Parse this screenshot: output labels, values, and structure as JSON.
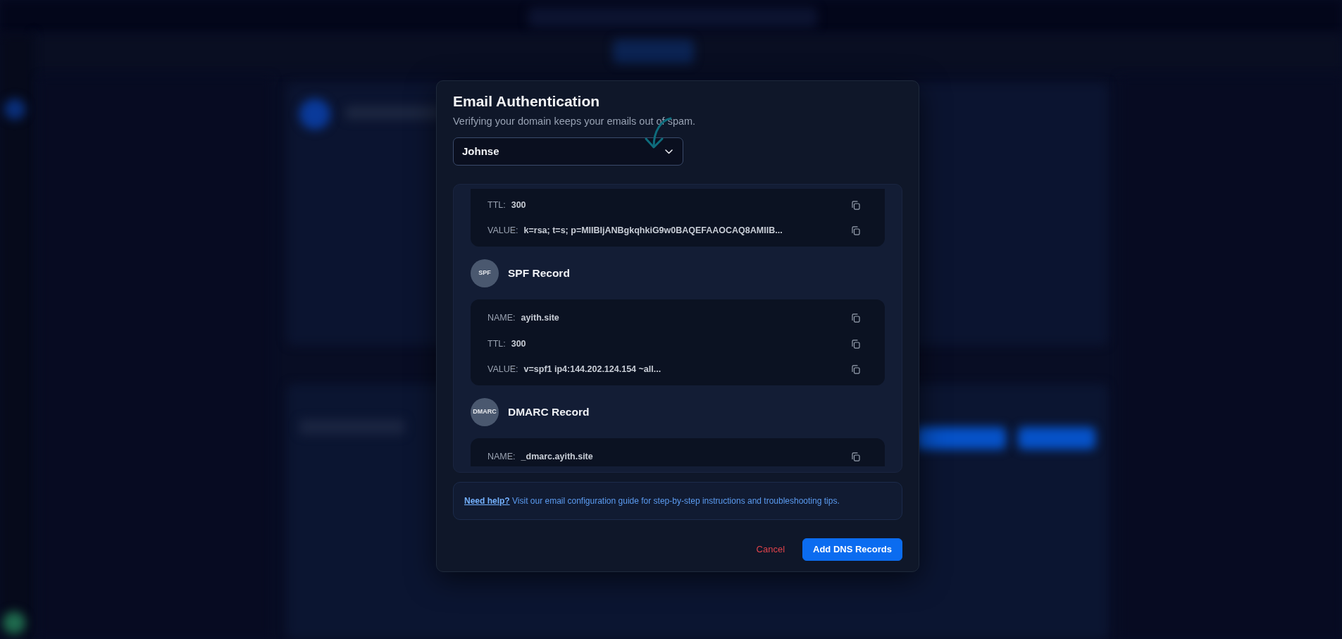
{
  "dialog": {
    "title": "Email Authentication",
    "subtitle": "Verifying your domain keeps your emails out of spam.",
    "domain_select": {
      "value": "Johnse"
    },
    "records": [
      {
        "rows": [
          {
            "label": "TTL:",
            "value": "300"
          },
          {
            "label": "VALUE:",
            "value": "k=rsa; t=s; p=MIIBIjANBgkqhkiG9w0BAQEFAAOCAQ8AMIIB..."
          }
        ]
      },
      {
        "badge": "SPF",
        "title": "SPF Record",
        "rows": [
          {
            "label": "NAME:",
            "value": "ayith.site"
          },
          {
            "label": "TTL:",
            "value": "300"
          },
          {
            "label": "VALUE:",
            "value": "v=spf1 ip4:144.202.124.154 ~all..."
          }
        ]
      },
      {
        "badge": "DMARC",
        "title": "DMARC Record",
        "rows": [
          {
            "label": "NAME:",
            "value": "_dmarc.ayith.site"
          }
        ]
      }
    ],
    "help": {
      "link": "Need help?",
      "text": "Visit our email configuration guide for step-by-step instructions and troubleshooting tips."
    },
    "buttons": [
      {
        "label": "Cancel",
        "kind": "link"
      },
      {
        "label": "Add DNS Records",
        "kind": "primary"
      }
    ]
  }
}
